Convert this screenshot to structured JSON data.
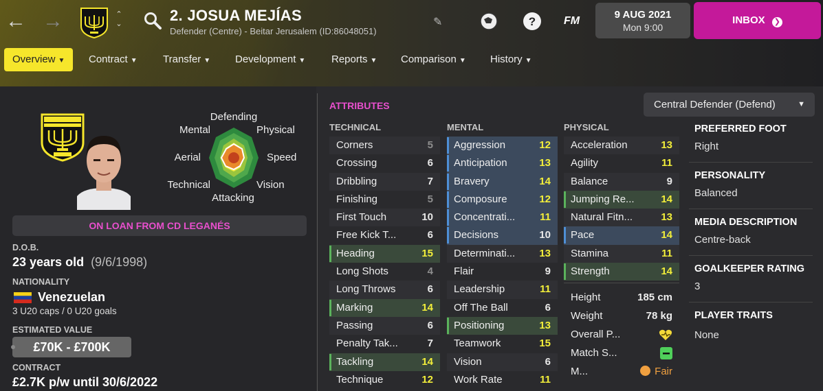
{
  "header": {
    "player_name": "2. JOSUA MEJÍAS",
    "subtitle": "Defender (Centre) - Beitar Jerusalem (ID:86048051)",
    "date": "9 AUG 2021",
    "time": "Mon 9:00",
    "inbox_label": "INBOX",
    "fm_label": "FM"
  },
  "tabs": [
    "Overview",
    "Contract",
    "Transfer",
    "Development",
    "Reports",
    "Comparison",
    "History"
  ],
  "radar_labels": {
    "defending": "Defending",
    "physical": "Physical",
    "speed": "Speed",
    "vision": "Vision",
    "attacking": "Attacking",
    "technical": "Technical",
    "aerial": "Aerial",
    "mental": "Mental"
  },
  "profile": {
    "loan_text": "ON LOAN FROM CD LEGANÉS",
    "dob_label": "D.O.B.",
    "age": "23 years old",
    "dob": "(9/6/1998)",
    "nationality_label": "NATIONALITY",
    "nationality": "Venezuelan",
    "caps": "3 U20 caps / 0 U20 goals",
    "value_label": "ESTIMATED VALUE",
    "value": "£70K - £700K",
    "contract_label": "CONTRACT",
    "contract": "£2.7K p/w until 30/6/2022"
  },
  "attributes": {
    "title": "ATTRIBUTES",
    "role": "Central Defender (Defend)",
    "technical_header": "TECHNICAL",
    "mental_header": "MENTAL",
    "physical_header": "PHYSICAL",
    "technical": [
      {
        "name": "Corners",
        "value": "5",
        "tier": "low",
        "hl": ""
      },
      {
        "name": "Crossing",
        "value": "6",
        "tier": "mid",
        "hl": ""
      },
      {
        "name": "Dribbling",
        "value": "7",
        "tier": "mid",
        "hl": ""
      },
      {
        "name": "Finishing",
        "value": "5",
        "tier": "low",
        "hl": ""
      },
      {
        "name": "First Touch",
        "value": "10",
        "tier": "mid",
        "hl": ""
      },
      {
        "name": "Free Kick T...",
        "value": "6",
        "tier": "mid",
        "hl": ""
      },
      {
        "name": "Heading",
        "value": "15",
        "tier": "good",
        "hl": "g"
      },
      {
        "name": "Long Shots",
        "value": "4",
        "tier": "low",
        "hl": ""
      },
      {
        "name": "Long Throws",
        "value": "6",
        "tier": "mid",
        "hl": ""
      },
      {
        "name": "Marking",
        "value": "14",
        "tier": "good",
        "hl": "g"
      },
      {
        "name": "Passing",
        "value": "6",
        "tier": "mid",
        "hl": ""
      },
      {
        "name": "Penalty Tak...",
        "value": "7",
        "tier": "mid",
        "hl": ""
      },
      {
        "name": "Tackling",
        "value": "14",
        "tier": "good",
        "hl": "g"
      },
      {
        "name": "Technique",
        "value": "12",
        "tier": "good",
        "hl": ""
      }
    ],
    "mental": [
      {
        "name": "Aggression",
        "value": "12",
        "tier": "good",
        "hl": "b"
      },
      {
        "name": "Anticipation",
        "value": "13",
        "tier": "good",
        "hl": "b"
      },
      {
        "name": "Bravery",
        "value": "14",
        "tier": "good",
        "hl": "b"
      },
      {
        "name": "Composure",
        "value": "12",
        "tier": "good",
        "hl": "b"
      },
      {
        "name": "Concentrati...",
        "value": "11",
        "tier": "good",
        "hl": "b"
      },
      {
        "name": "Decisions",
        "value": "10",
        "tier": "mid",
        "hl": "b"
      },
      {
        "name": "Determinati...",
        "value": "13",
        "tier": "good",
        "hl": ""
      },
      {
        "name": "Flair",
        "value": "9",
        "tier": "mid",
        "hl": ""
      },
      {
        "name": "Leadership",
        "value": "11",
        "tier": "good",
        "hl": ""
      },
      {
        "name": "Off The Ball",
        "value": "6",
        "tier": "mid",
        "hl": ""
      },
      {
        "name": "Positioning",
        "value": "13",
        "tier": "good",
        "hl": "g"
      },
      {
        "name": "Teamwork",
        "value": "15",
        "tier": "good",
        "hl": ""
      },
      {
        "name": "Vision",
        "value": "6",
        "tier": "mid",
        "hl": ""
      },
      {
        "name": "Work Rate",
        "value": "11",
        "tier": "good",
        "hl": ""
      }
    ],
    "physical": [
      {
        "name": "Acceleration",
        "value": "13",
        "tier": "good",
        "hl": ""
      },
      {
        "name": "Agility",
        "value": "11",
        "tier": "good",
        "hl": ""
      },
      {
        "name": "Balance",
        "value": "9",
        "tier": "mid",
        "hl": ""
      },
      {
        "name": "Jumping Re...",
        "value": "14",
        "tier": "good",
        "hl": "g"
      },
      {
        "name": "Natural Fitn...",
        "value": "13",
        "tier": "good",
        "hl": ""
      },
      {
        "name": "Pace",
        "value": "14",
        "tier": "good",
        "hl": "b"
      },
      {
        "name": "Stamina",
        "value": "11",
        "tier": "good",
        "hl": ""
      },
      {
        "name": "Strength",
        "value": "14",
        "tier": "good",
        "hl": "g"
      }
    ],
    "stats": {
      "height_label": "Height",
      "height": "185 cm",
      "weight_label": "Weight",
      "weight": "78 kg",
      "overall_label": "Overall P...",
      "match_label": "Match S...",
      "morale_label": "M...",
      "morale": "Fair"
    }
  },
  "right_panel": {
    "foot_label": "PREFERRED FOOT",
    "foot": "Right",
    "personality_label": "PERSONALITY",
    "personality": "Balanced",
    "media_label": "MEDIA DESCRIPTION",
    "media": "Centre-back",
    "gk_label": "GOALKEEPER RATING",
    "gk": "3",
    "traits_label": "PLAYER TRAITS",
    "traits": "None"
  },
  "colors": {
    "accent_yellow": "#f6e62b",
    "accent_pink": "#e94fce",
    "inbox_bg": "#c4199a",
    "good_value": "#f3ef3a"
  }
}
